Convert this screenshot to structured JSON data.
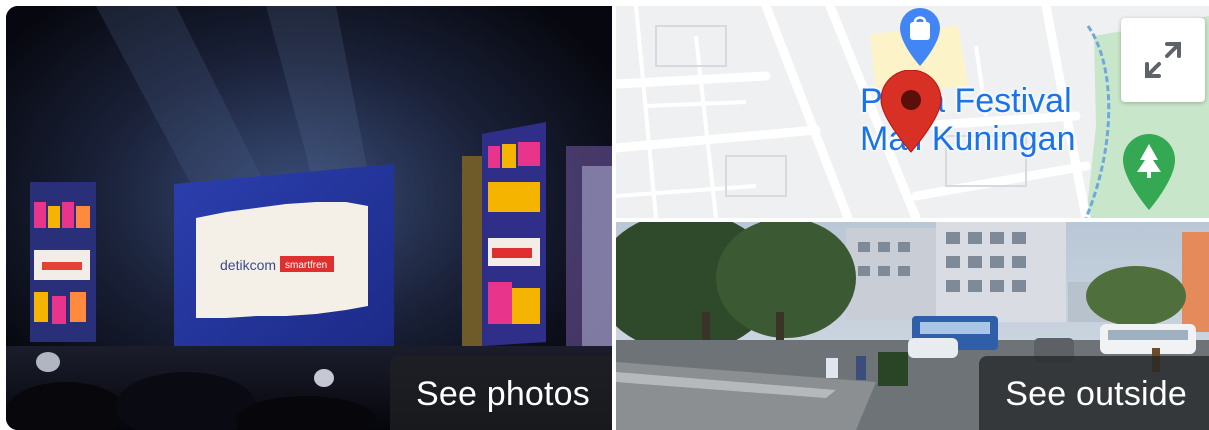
{
  "photos": {
    "see_photos_label": "See photos",
    "stage_screen_text": "detikcom | smartfren",
    "side_banner_text": "smartfren"
  },
  "map": {
    "place_name_line1": "Plaza Festival",
    "place_name_line2": "Mall Kuningan",
    "expand_icon": "expand-arrows-icon",
    "marker_icon": "location-pin-icon",
    "shopping_icon": "shopping-bag-icon",
    "park_icon": "tree-icon",
    "colors": {
      "place_label": "#1a73e8",
      "marker": "#d93025",
      "shopping_pin": "#4285f4",
      "park_pin": "#34a853",
      "park_area": "#c8e6c9"
    }
  },
  "street_view": {
    "see_outside_label": "See outside"
  }
}
